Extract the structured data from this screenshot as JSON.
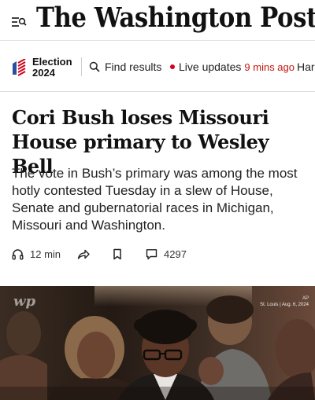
{
  "masthead": {
    "logo_text": "The Washington Post",
    "menu_icon": "menu-search-icon"
  },
  "subnav": {
    "election_line1": "Election",
    "election_line2": "2024",
    "find_results": "Find results",
    "live_updates": "Live updates",
    "live_ago": "9 mins ago",
    "next_item": "Har"
  },
  "article": {
    "headline": "Cori Bush loses Missouri House primary to Wesley Bell",
    "dek": "The vote in Bush’s primary was among the most hotly contested Tuesday in a slew of House, Senate and gubernatorial races in Michigan, Missouri and Washington.",
    "listen_time": "12 min",
    "comment_count": "4297"
  },
  "photo": {
    "watermark": "wp",
    "credit_agency": "AP",
    "credit_location": "St. Louis | Aug. 6, 2024"
  },
  "colors": {
    "live_dot": "#d0021b",
    "live_ago": "#c4160f",
    "flag_blue": "#2a4fa0",
    "flag_red": "#d0021b"
  }
}
